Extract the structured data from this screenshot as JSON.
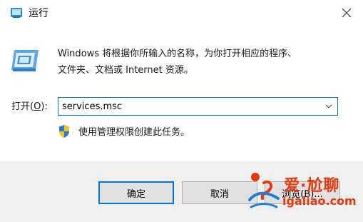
{
  "window": {
    "title": "运行"
  },
  "description": {
    "line1": "Windows 将根据你所输入的名称，为你打开相应的程序、",
    "line2": "文件夹、文档或 Internet 资源。"
  },
  "open": {
    "label_prefix": "打开(",
    "label_key": "O",
    "label_suffix": "):",
    "value": "services.msc"
  },
  "admin_note": "使用管理权限创建此任务。",
  "buttons": {
    "ok": "确定",
    "cancel": "取消",
    "browse": "浏览(B)..."
  },
  "watermark": {
    "top": "爱·尬聊",
    "bottom": "igaliao.com"
  },
  "icons": {
    "app": "run-app-icon",
    "close": "close-icon",
    "run": "run-dialog-icon",
    "dropdown": "chevron-down-icon",
    "shield": "uac-shield-icon"
  },
  "colors": {
    "accent": "#0078d7",
    "footer": "#f0f0f0",
    "button": "#e1e1e1",
    "watermark": "#e8380d"
  }
}
